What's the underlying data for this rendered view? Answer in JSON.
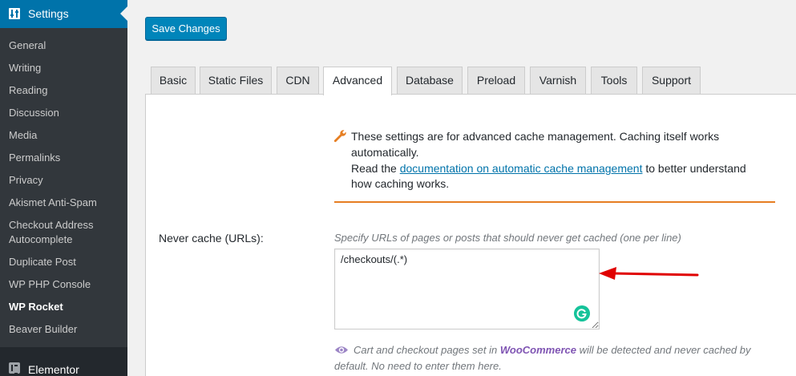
{
  "sidebar": {
    "header_label": "Settings",
    "items": [
      {
        "label": "General"
      },
      {
        "label": "Writing"
      },
      {
        "label": "Reading"
      },
      {
        "label": "Discussion"
      },
      {
        "label": "Media"
      },
      {
        "label": "Permalinks"
      },
      {
        "label": "Privacy"
      },
      {
        "label": "Akismet Anti-Spam"
      },
      {
        "label": "Checkout Address Autocomplete"
      },
      {
        "label": "Duplicate Post"
      },
      {
        "label": "WP PHP Console"
      },
      {
        "label": "WP Rocket",
        "current": true
      },
      {
        "label": "Beaver Builder"
      }
    ],
    "footer_label": "Elementor"
  },
  "toolbar": {
    "save_label": "Save Changes"
  },
  "tabs": [
    {
      "label": "Basic"
    },
    {
      "label": "Static Files"
    },
    {
      "label": "CDN"
    },
    {
      "label": "Advanced",
      "active": true
    },
    {
      "label": "Database"
    },
    {
      "label": "Preload"
    },
    {
      "label": "Varnish"
    },
    {
      "label": "Tools"
    },
    {
      "label": "Support"
    }
  ],
  "notice": {
    "line1": "These settings are for advanced cache management. Caching itself works",
    "line2": "automatically.",
    "line3_before": "Read the ",
    "line3_link": "documentation on automatic cache management",
    "line3_after": " to better understand",
    "line4": "how caching works.",
    "accent_color": "#e67e22"
  },
  "never_cache": {
    "label": "Never cache (URLs):",
    "description": "Specify URLs of pages or posts that should never get cached (one per line)",
    "value": "/checkouts/(.*)"
  },
  "footnote": {
    "line1_before": "Cart and checkout pages set in ",
    "line1_strong": "WooCommerce",
    "line1_after": " will be detected and never cached by",
    "line2": "default. No need to enter them here."
  },
  "colors": {
    "primary": "#0085ba",
    "sidebar_bg": "#23282d",
    "submenu_bg": "#32373c",
    "annotation_arrow": "#e00000"
  },
  "icons": {
    "settings": "settings-sliders-icon",
    "notice": "wrench-icon",
    "footnote": "eye-icon",
    "elementor": "elementor-icon",
    "grammarly": "grammarly-icon"
  }
}
